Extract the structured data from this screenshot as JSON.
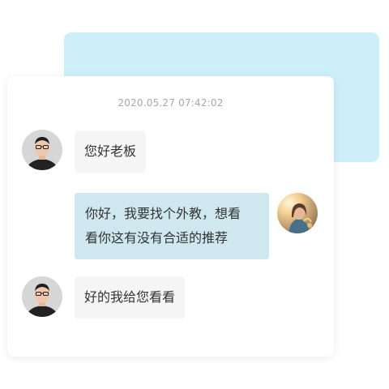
{
  "chat": {
    "timestamp": "2020.05.27 07:42:02",
    "messages": [
      {
        "sender": "boss",
        "text": "您好老板"
      },
      {
        "sender": "user",
        "line1": "你好，我要找个外教，想看",
        "line2": "看你这有没有合适的推荐"
      },
      {
        "sender": "boss",
        "text": "好的我给您看看"
      }
    ]
  },
  "colors": {
    "accent_card": "#cdeff9",
    "outgoing_bubble": "#cfe8f0",
    "incoming_bubble": "#f5f5f5"
  },
  "icons": {
    "boss_avatar": "man-with-glasses-avatar",
    "user_avatar": "woman-sunlight-avatar"
  }
}
